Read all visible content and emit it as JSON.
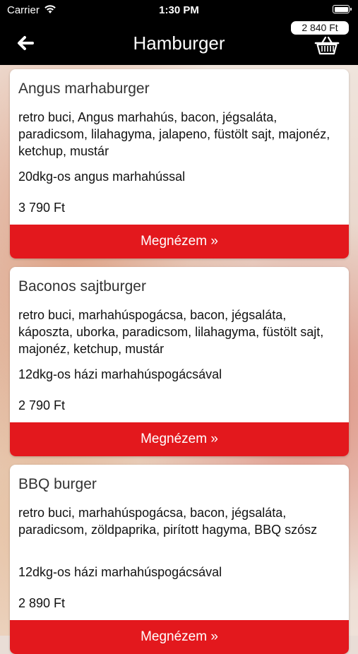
{
  "status_bar": {
    "carrier": "Carrier",
    "time": "1:30 PM"
  },
  "nav": {
    "title": "Hamburger",
    "cart_total": "2 840 Ft"
  },
  "products": [
    {
      "name": "Angus marhaburger",
      "description": "retro buci, Angus marhahús, bacon, jégsaláta, paradicsom, lilahagyma, jalapeno, füstölt sajt, majonéz, ketchup, mustár",
      "note": "20dkg-os angus marhahússal",
      "price": "3 790 Ft",
      "button": "Megnézem »"
    },
    {
      "name": "Baconos sajtburger",
      "description": "retro buci, marhahúspogácsa, bacon, jégsaláta, káposzta, uborka, paradicsom, lilahagyma, füstölt sajt, majonéz, ketchup, mustár",
      "note": "12dkg-os házi marhahúspogácsával",
      "price": "2 790 Ft",
      "button": "Megnézem »"
    },
    {
      "name": "BBQ burger",
      "description": "retro buci, marhahúspogácsa, bacon, jégsaláta, paradicsom, zöldpaprika, pirított hagyma, BBQ szósz",
      "note": "12dkg-os házi marhahúspogácsával",
      "price": "2 890 Ft",
      "button": "Megnézem »"
    }
  ],
  "icons": {
    "back": "arrow-left-icon",
    "basket": "basket-icon",
    "wifi": "wifi-icon",
    "battery": "battery-icon"
  },
  "colors": {
    "accent": "#e3181d",
    "bar": "#000000"
  }
}
